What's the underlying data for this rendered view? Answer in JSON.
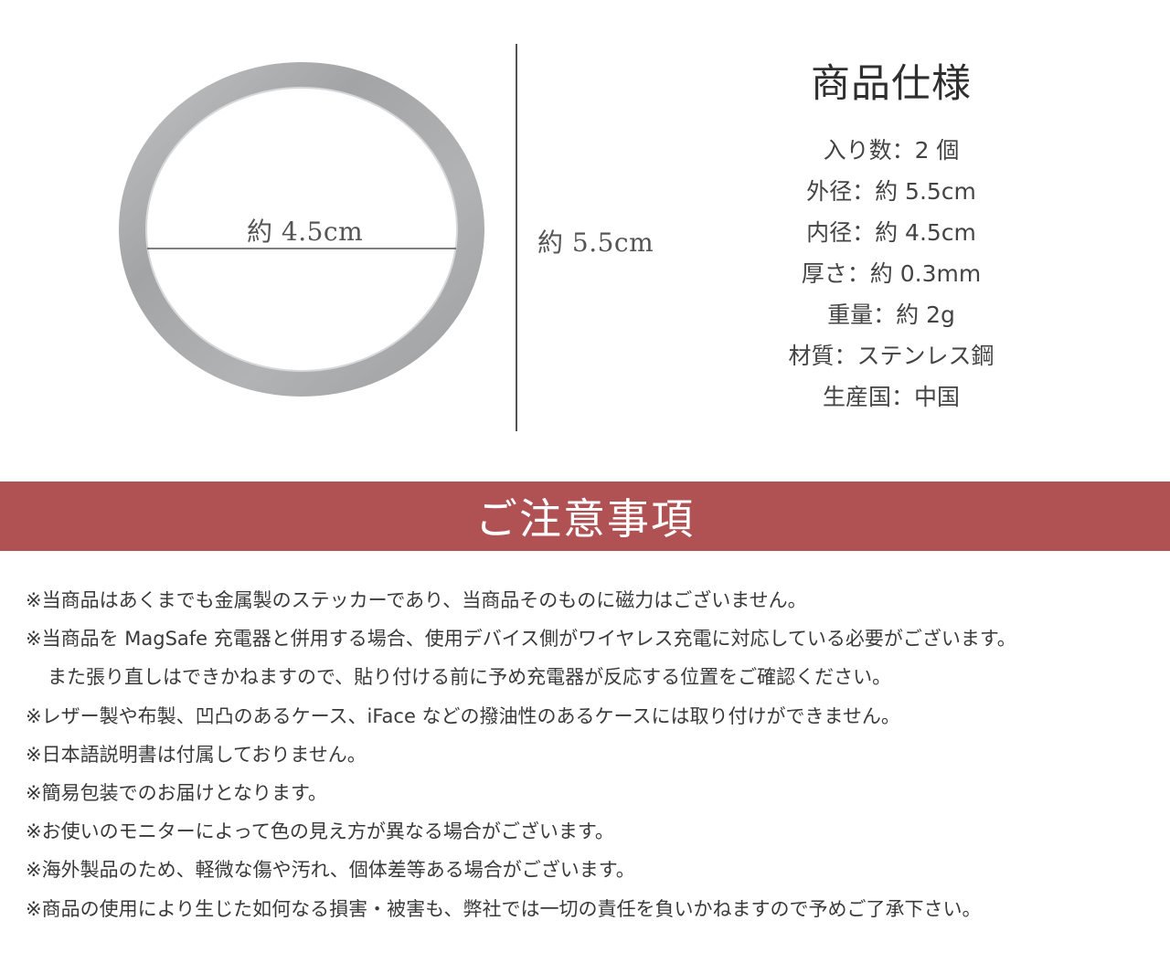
{
  "figure": {
    "inner_label": "約 4.5cm",
    "outer_label": "約 5.5cm"
  },
  "spec": {
    "title": "商品仕様",
    "items": [
      "入り数：2 個",
      "外径：約 5.5cm",
      "内径：約 4.5cm",
      "厚さ：約 0.3mm",
      "重量：約 2g",
      "材質：ステンレス鋼",
      "生産国：中国"
    ]
  },
  "notice": {
    "title": "ご注意事項",
    "lines": [
      "※当商品はあくまでも金属製のステッカーであり、当商品そのものに磁力はございません。",
      "※当商品を MagSafe 充電器と併用する場合、使用デバイス側がワイヤレス充電に対応している必要がございます。",
      "また張り直しはできかねますので、貼り付ける前に予め充電器が反応する位置をご確認ください。",
      "※レザー製や布製、凹凸のあるケース、iFace などの撥油性のあるケースには取り付けができません。",
      "※日本語説明書は付属しておりません。",
      "※簡易包装でのお届けとなります。",
      "※お使いのモニターによって色の見え方が異なる場合がございます。",
      "※海外製品のため、軽微な傷や汚れ、個体差等ある場合がございます。",
      "※商品の使用により生じた如何なる損害・被害も、弊社では一切の責任を負いかねますので予めご了承下さい。"
    ]
  },
  "colors": {
    "banner": "#b05254",
    "ring": "#a9aaac"
  }
}
